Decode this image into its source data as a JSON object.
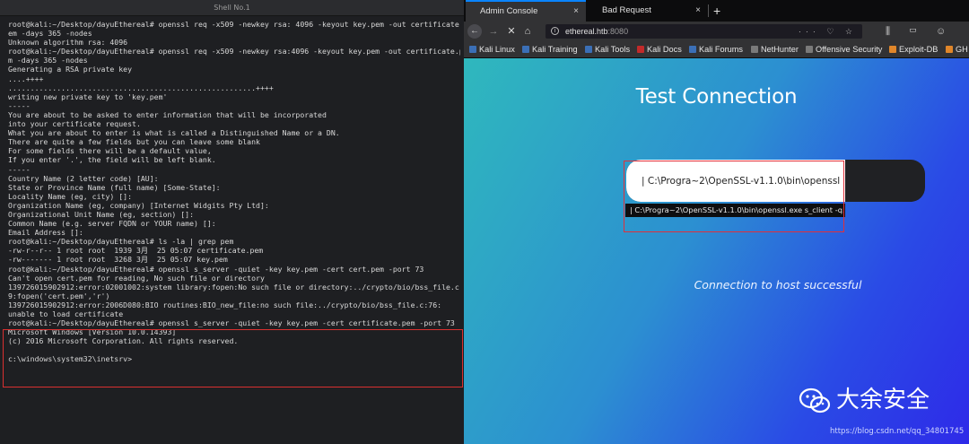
{
  "terminal": {
    "title": "Shell No.1",
    "lines": [
      "root@kali:~/Desktop/dayuEthereal# openssl req -x509 -newkey rsa: 4096 -keyout key.pem -out certificate.p",
      "em -days 365 -nodes",
      "Unknown algorithm rsa: 4096",
      "root@kali:~/Desktop/dayuEthereal# openssl req -x509 -newkey rsa:4096 -keyout key.pem -out certificate.pe",
      "m -days 365 -nodes",
      "Generating a RSA private key",
      "....++++",
      "........................................................++++",
      "writing new private key to 'key.pem'",
      "-----",
      "You are about to be asked to enter information that will be incorporated",
      "into your certificate request.",
      "What you are about to enter is what is called a Distinguished Name or a DN.",
      "There are quite a few fields but you can leave some blank",
      "For some fields there will be a default value,",
      "If you enter '.', the field will be left blank.",
      "-----",
      "Country Name (2 letter code) [AU]:",
      "State or Province Name (full name) [Some-State]:",
      "Locality Name (eg, city) []:",
      "Organization Name (eg, company) [Internet Widgits Pty Ltd]:",
      "Organizational Unit Name (eg, section) []:",
      "Common Name (e.g. server FQDN or YOUR name) []:",
      "Email Address []:",
      "root@kali:~/Desktop/dayuEthereal# ls -la | grep pem",
      "-rw-r--r-- 1 root root  1939 3月  25 05:07 certificate.pem",
      "-rw------- 1 root root  3268 3月  25 05:07 key.pem",
      "root@kali:~/Desktop/dayuEthereal# openssl s_server -quiet -key key.pem -cert cert.pem -port 73",
      "Can't open cert.pem for reading, No such file or directory",
      "139726015902912:error:02001002:system library:fopen:No such file or directory:../crypto/bio/bss_file.c:6",
      "9:fopen('cert.pem','r')",
      "139726015902912:error:2006D080:BIO routines:BIO_new_file:no such file:../crypto/bio/bss_file.c:76:",
      "unable to load certificate",
      "root@kali:~/Desktop/dayuEthereal# openssl s_server -quiet -key key.pem -cert certificate.pem -port 73",
      "Microsoft Windows [Version 10.0.14393]",
      "(c) 2016 Microsoft Corporation. All rights reserved.",
      "",
      "c:\\windows\\system32\\inetsrv>"
    ]
  },
  "browser": {
    "tabs": [
      {
        "label": "Admin Console",
        "close": "×"
      },
      {
        "label": "Bad Request",
        "close": "×"
      }
    ],
    "new_tab": "+",
    "nav": {
      "back": "←",
      "forward": "→",
      "stop": "✕",
      "home": "⌂"
    },
    "url": {
      "host": "ethereal.htb",
      "port": ":8080",
      "right_icons": "··· ♡ ☆",
      "tools": "⫼ ▭ ☺ ≡"
    },
    "bookmarks": [
      {
        "label": "Kali Linux",
        "icon": "kali-icon"
      },
      {
        "label": "Kali Training",
        "icon": "kali-icon"
      },
      {
        "label": "Kali Tools",
        "icon": "kali-icon"
      },
      {
        "label": "Kali Docs",
        "icon": "kali-docs-icon"
      },
      {
        "label": "Kali Forums",
        "icon": "kali-icon"
      },
      {
        "label": "NetHunter",
        "icon": "nethunter-icon"
      },
      {
        "label": "Offensive Security",
        "icon": "offsec-icon"
      },
      {
        "label": "Exploit-DB",
        "icon": "exploitdb-icon"
      },
      {
        "label": "GH",
        "icon": "ghdb-icon"
      }
    ]
  },
  "page": {
    "title": "Test Connection",
    "input_value": "| C:\\Progra~2\\OpenSSL-v1.1.0\\bin\\openssl",
    "suggestion": "| C:\\Progra~2\\OpenSSL-v1.1.0\\bin\\openssl.exe s_client -q...",
    "status": "Connection to host successful"
  },
  "watermark": {
    "brand": "大余安全",
    "url": "https://blog.csdn.net/qq_34801745"
  },
  "colors": {
    "highlight_red": "#e0303a",
    "gradient_start": "#2fb8bd",
    "gradient_end": "#2e2ae8",
    "tab_accent": "#0a84ff"
  }
}
